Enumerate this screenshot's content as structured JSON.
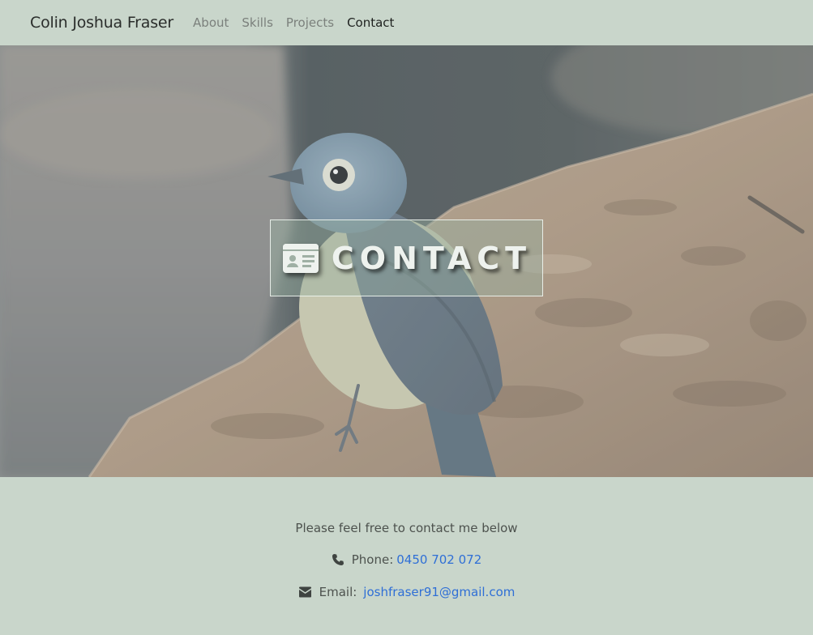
{
  "nav": {
    "brand": "Colin Joshua Fraser",
    "links": [
      "About",
      "Skills",
      "Projects",
      "Contact"
    ],
    "active": "Contact"
  },
  "hero": {
    "title": "CONTACT",
    "icon": "id-card-icon",
    "image_description_icon": "bird-photo"
  },
  "contact": {
    "intro": "Please feel free to contact me below",
    "phone_label": "Phone:",
    "phone_value": "0450 702 072",
    "phone_icon": "phone-icon",
    "email_label": "Email:",
    "email_value": "joshfraser91@gmail.com",
    "email_icon": "envelope-icon"
  },
  "colors": {
    "background": "#c9d6cb",
    "link": "#2f6fd6",
    "nav_active": "#1e211f",
    "nav_inactive": "#7b807c"
  }
}
